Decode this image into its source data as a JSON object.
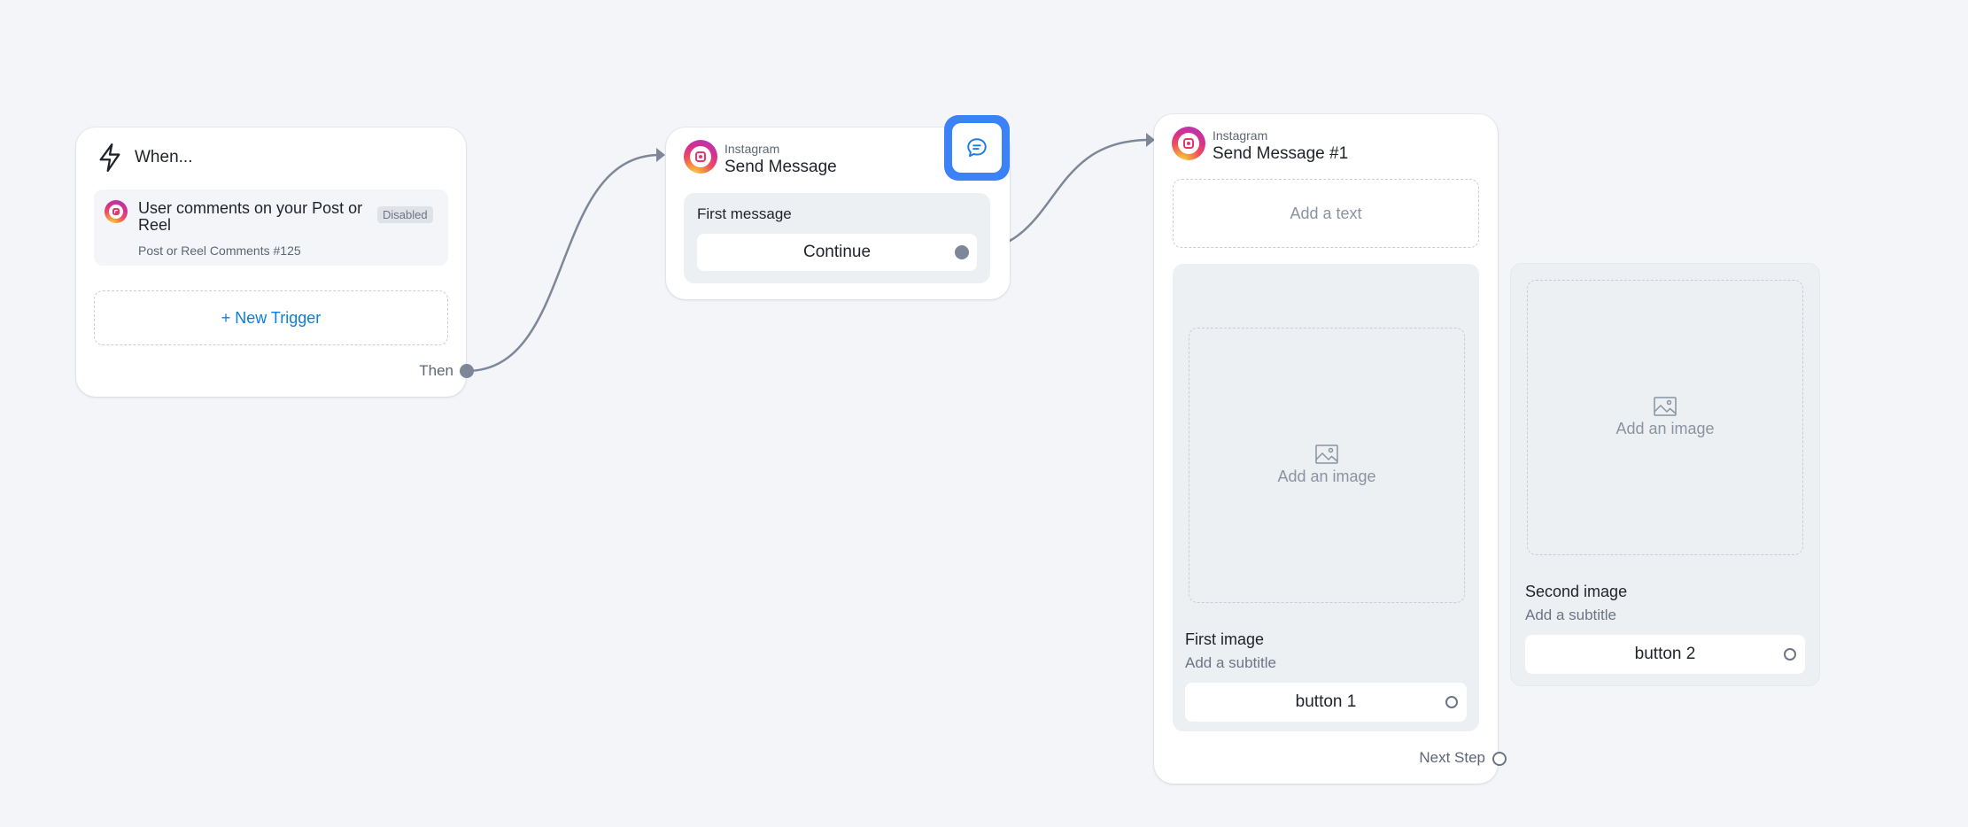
{
  "colors": {
    "canvas": "#f3f5f8",
    "accent_blue": "#0a7ee0",
    "selection_blue": "#3b82f6",
    "connector": "#7d8797"
  },
  "trigger_node": {
    "header": "When...",
    "header_icon": "lightning-icon",
    "trigger": {
      "title": "User comments on your Post or Reel",
      "badge": "Disabled",
      "subtitle": "Post or Reel Comments #125",
      "icon": "instagram-icon"
    },
    "new_trigger_label": "+ New Trigger",
    "then_label": "Then"
  },
  "send_message_node": {
    "platform": "Instagram",
    "title": "Send Message",
    "action_icon": "chat-bubble-icon",
    "message_label": "First message",
    "button_label": "Continue"
  },
  "send_message_1_node": {
    "platform": "Instagram",
    "title": "Send Message #1",
    "add_text_placeholder": "Add a text",
    "cards": [
      {
        "image_placeholder": "Add an image",
        "title": "First image",
        "subtitle": "Add a subtitle",
        "button_label": "button 1"
      },
      {
        "image_placeholder": "Add an image",
        "title": "Second image",
        "subtitle": "Add a subtitle",
        "button_label": "button 2"
      }
    ],
    "next_step_label": "Next Step"
  }
}
